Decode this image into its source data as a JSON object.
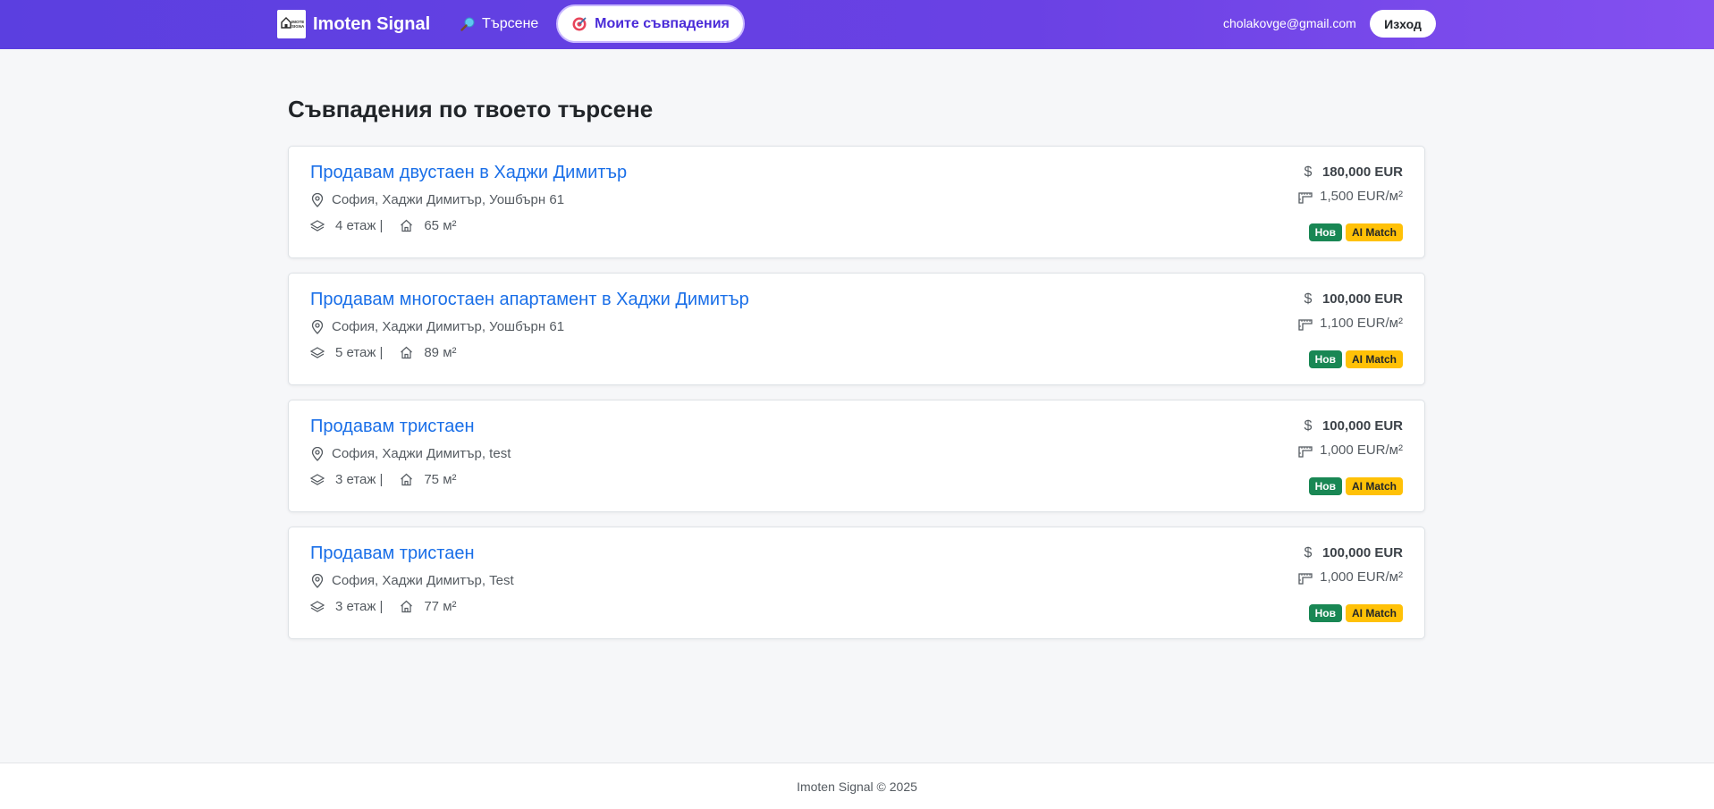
{
  "navbar": {
    "brand_name": "Imoten Signal",
    "logo_text": "IMOTEN SIGNAL",
    "search_label": "Търсене",
    "search_icon": "magnifier-icon",
    "matches_label": "Моите съвпадения",
    "matches_icon": "target-icon",
    "user_email": "cholakovge@gmail.com",
    "logout_label": "Изход"
  },
  "page": {
    "title": "Съвпадения по твоето търсене"
  },
  "listings": [
    {
      "title": "Продавам двустаен в Хаджи Димитър",
      "address": "София, Хаджи Димитър, Уошбърн 61",
      "floor": "4 етаж",
      "separator": "|",
      "area": "65 м²",
      "price": "180,000 EUR",
      "price_per_sqm": "1,500 EUR/м²",
      "badge_new": "Нов",
      "badge_ai": "AI Match"
    },
    {
      "title": "Продавам многостаен апартамент в Хаджи Димитър",
      "address": "София, Хаджи Димитър, Уошбърн 61",
      "floor": "5 етаж",
      "separator": "|",
      "area": "89 м²",
      "price": "100,000 EUR",
      "price_per_sqm": "1,100 EUR/м²",
      "badge_new": "Нов",
      "badge_ai": "AI Match"
    },
    {
      "title": "Продавам тристаен",
      "address": "София, Хаджи Димитър, test",
      "floor": "3 етаж",
      "separator": "|",
      "area": "75 м²",
      "price": "100,000 EUR",
      "price_per_sqm": "1,000 EUR/м²",
      "badge_new": "Нов",
      "badge_ai": "AI Match"
    },
    {
      "title": "Продавам тристаен",
      "address": "София, Хаджи Димитър, Test",
      "floor": "3 етаж",
      "separator": "|",
      "area": "77 м²",
      "price": "100,000 EUR",
      "price_per_sqm": "1,000 EUR/м²",
      "badge_new": "Нов",
      "badge_ai": "AI Match"
    }
  ],
  "footer": {
    "text": "Imoten Signal © 2025"
  },
  "colors": {
    "navbar_gradient_start": "#5b3fe0",
    "navbar_gradient_end": "#8450f0",
    "link_blue": "#1a6fe8",
    "badge_new": "#198754",
    "badge_ai": "#ffc107"
  }
}
